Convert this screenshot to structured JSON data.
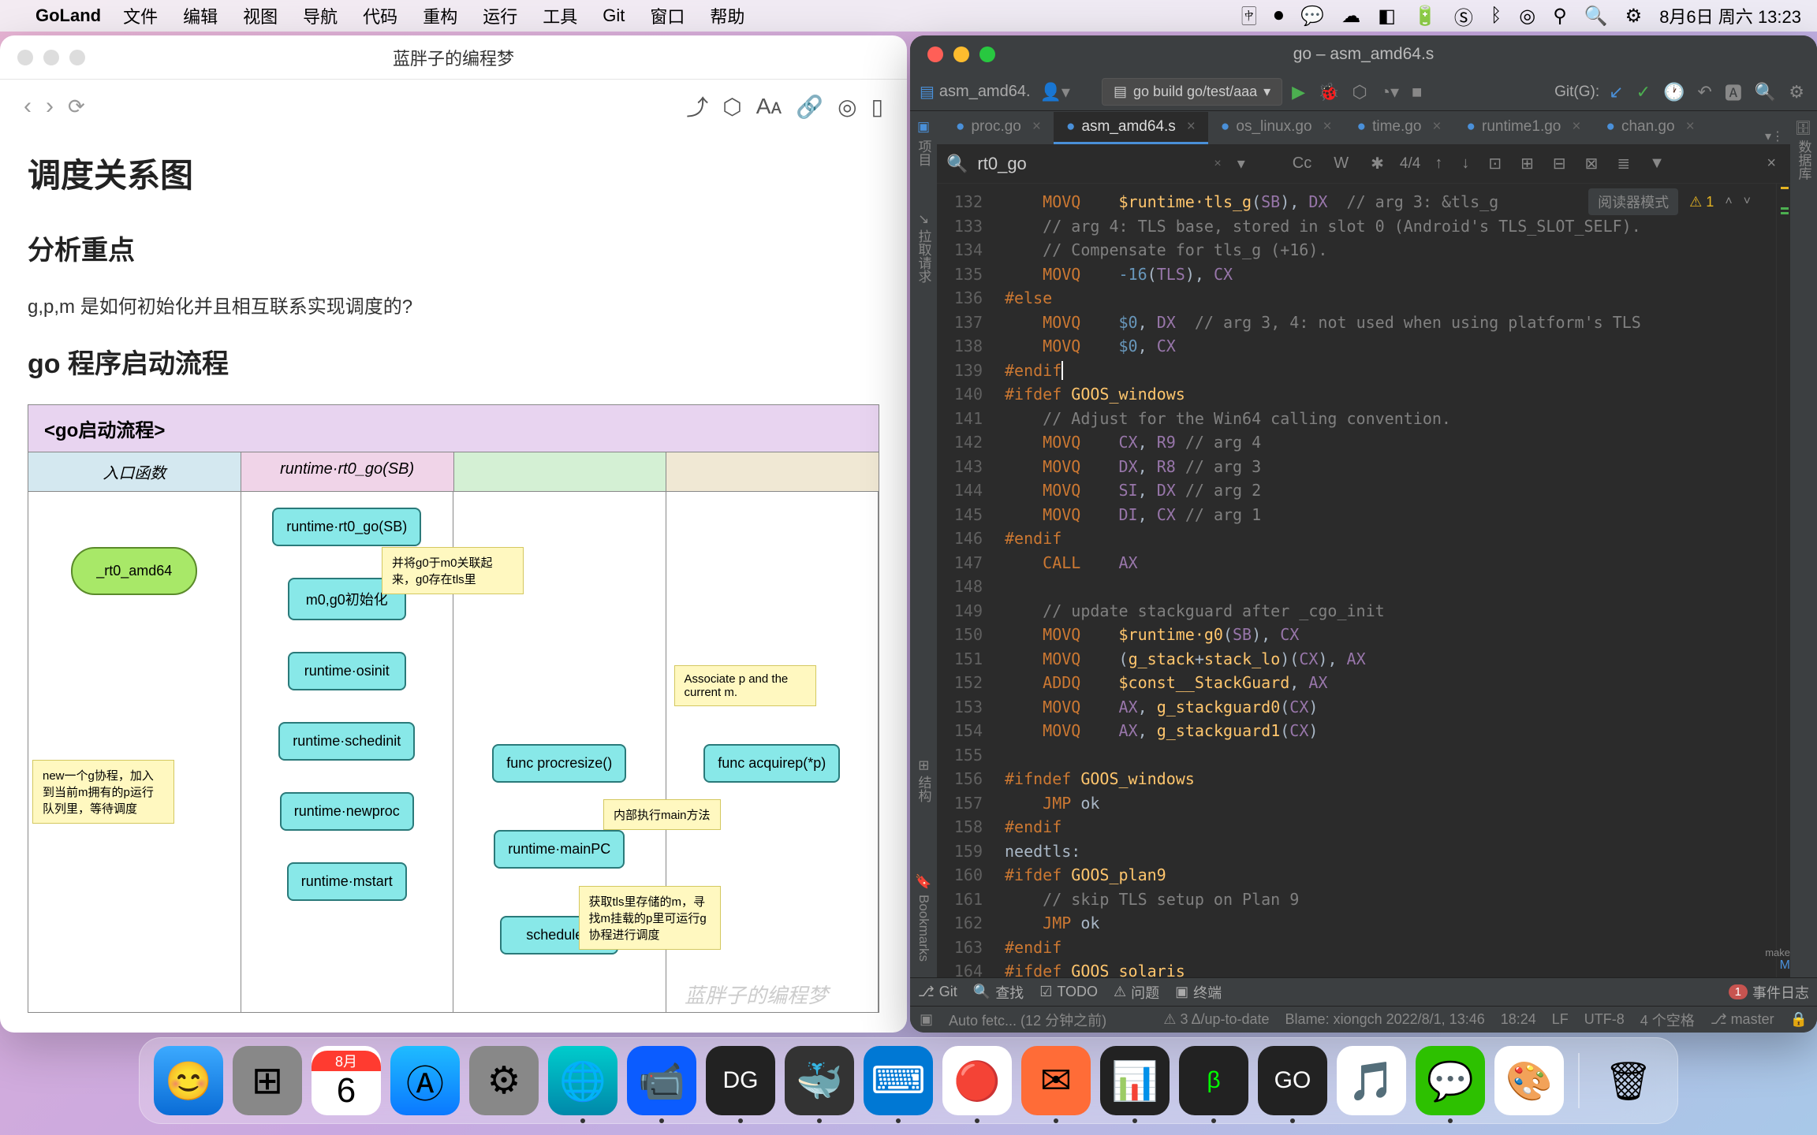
{
  "menubar": {
    "app": "GoLand",
    "items": [
      "文件",
      "编辑",
      "视图",
      "导航",
      "代码",
      "重构",
      "运行",
      "工具",
      "Git",
      "窗口",
      "帮助"
    ],
    "date": "8月6日",
    "weekday": "周六",
    "time": "13:23"
  },
  "notes": {
    "title": "蓝胖子的编程梦",
    "h1": "调度关系图",
    "h2a": "分析重点",
    "para1": "g,p,m 是如何初始化并且相互联系实现调度的?",
    "h2b": "go 程序启动流程",
    "flowchart": {
      "title": "<go启动流程>",
      "cols": [
        "入口函数",
        "runtime·rt0_go(SB)",
        "",
        ""
      ],
      "nodes": {
        "start": "_rt0_amd64",
        "n1": "runtime·rt0_go(SB)",
        "n2": "m0,g0初始化",
        "n3": "runtime·osinit",
        "n4": "runtime·schedinit",
        "n5": "runtime·newproc",
        "n6": "runtime·mstart",
        "n7": "func procresize()",
        "n8": "runtime·mainPC",
        "n9": "schedule()",
        "n10": "func acquirep(*p)"
      },
      "notes": {
        "note1": "并将g0于m0关联起来，g0存在tls里",
        "note2": "Associate p and the current m.",
        "note3": "new一个g协程，加入到当前m拥有的p运行队列里，等待调度",
        "note4": "内部执行main方法",
        "note5": "获取tls里存储的m，寻找m挂载的p里可运行g协程进行调度"
      }
    },
    "watermark": "蓝胖子的编程梦"
  },
  "ide": {
    "title": "go – asm_amd64.s",
    "crumb": "asm_amd64.",
    "run_config": "go build go/test/aaa",
    "git_label": "Git(G):",
    "tabs": [
      {
        "name": "proc.go",
        "active": false
      },
      {
        "name": "asm_amd64.s",
        "active": true
      },
      {
        "name": "os_linux.go",
        "active": false
      },
      {
        "name": "time.go",
        "active": false
      },
      {
        "name": "runtime1.go",
        "active": false
      },
      {
        "name": "chan.go",
        "active": false
      }
    ],
    "search": {
      "query": "rt0_go",
      "match": "4/4",
      "cc": "Cc",
      "w": "W"
    },
    "reader_mode": "阅读器模式",
    "warn_count": "1",
    "left_tool_tabs": [
      "项目",
      "拉取请求",
      "结构",
      "Bookmarks"
    ],
    "right_tool_tabs": [
      "数据库"
    ],
    "gutter_start": 132,
    "code": [
      {
        "indent": 2,
        "t": [
          {
            "c": "kw",
            "s": "MOVQ"
          },
          {
            "s": "    "
          },
          {
            "c": "fn",
            "s": "$runtime·tls_g"
          },
          {
            "s": "("
          },
          {
            "c": "reg",
            "s": "SB"
          },
          {
            "s": "), "
          },
          {
            "c": "reg",
            "s": "DX"
          },
          {
            "s": "  "
          },
          {
            "c": "cmt",
            "s": "// arg 3: &tls_g"
          }
        ]
      },
      {
        "indent": 2,
        "t": [
          {
            "c": "cmt",
            "s": "// arg 4: TLS base, stored in slot 0 (Android's TLS_SLOT_SELF)."
          }
        ]
      },
      {
        "indent": 2,
        "t": [
          {
            "c": "cmt",
            "s": "// Compensate for tls_g (+16)."
          }
        ]
      },
      {
        "indent": 2,
        "t": [
          {
            "c": "kw",
            "s": "MOVQ"
          },
          {
            "s": "    "
          },
          {
            "c": "num",
            "s": "-16"
          },
          {
            "s": "("
          },
          {
            "c": "reg",
            "s": "TLS"
          },
          {
            "s": "), "
          },
          {
            "c": "reg",
            "s": "CX"
          }
        ]
      },
      {
        "indent": 0,
        "t": [
          {
            "c": "pp",
            "s": "#else"
          }
        ]
      },
      {
        "indent": 2,
        "t": [
          {
            "c": "kw",
            "s": "MOVQ"
          },
          {
            "s": "    "
          },
          {
            "c": "num",
            "s": "$0"
          },
          {
            "s": ", "
          },
          {
            "c": "reg",
            "s": "DX"
          },
          {
            "s": "  "
          },
          {
            "c": "cmt",
            "s": "// arg 3, 4: not used when using platform's TLS"
          }
        ]
      },
      {
        "indent": 2,
        "t": [
          {
            "c": "kw",
            "s": "MOVQ"
          },
          {
            "s": "    "
          },
          {
            "c": "num",
            "s": "$0"
          },
          {
            "s": ", "
          },
          {
            "c": "reg",
            "s": "CX"
          }
        ]
      },
      {
        "indent": 0,
        "t": [
          {
            "c": "pp",
            "s": "#endif"
          }
        ],
        "cursor": true
      },
      {
        "indent": 0,
        "t": [
          {
            "c": "pp",
            "s": "#ifdef "
          },
          {
            "c": "ppname",
            "s": "GOOS_windows"
          }
        ]
      },
      {
        "indent": 2,
        "t": [
          {
            "c": "cmt",
            "s": "// Adjust for the Win64 calling convention."
          }
        ]
      },
      {
        "indent": 2,
        "t": [
          {
            "c": "kw",
            "s": "MOVQ"
          },
          {
            "s": "    "
          },
          {
            "c": "reg",
            "s": "CX"
          },
          {
            "s": ", "
          },
          {
            "c": "reg",
            "s": "R9"
          },
          {
            "s": " "
          },
          {
            "c": "cmt",
            "s": "// arg 4"
          }
        ]
      },
      {
        "indent": 2,
        "t": [
          {
            "c": "kw",
            "s": "MOVQ"
          },
          {
            "s": "    "
          },
          {
            "c": "reg",
            "s": "DX"
          },
          {
            "s": ", "
          },
          {
            "c": "reg",
            "s": "R8"
          },
          {
            "s": " "
          },
          {
            "c": "cmt",
            "s": "// arg 3"
          }
        ]
      },
      {
        "indent": 2,
        "t": [
          {
            "c": "kw",
            "s": "MOVQ"
          },
          {
            "s": "    "
          },
          {
            "c": "reg",
            "s": "SI"
          },
          {
            "s": ", "
          },
          {
            "c": "reg",
            "s": "DX"
          },
          {
            "s": " "
          },
          {
            "c": "cmt",
            "s": "// arg 2"
          }
        ]
      },
      {
        "indent": 2,
        "t": [
          {
            "c": "kw",
            "s": "MOVQ"
          },
          {
            "s": "    "
          },
          {
            "c": "reg",
            "s": "DI"
          },
          {
            "s": ", "
          },
          {
            "c": "reg",
            "s": "CX"
          },
          {
            "s": " "
          },
          {
            "c": "cmt",
            "s": "// arg 1"
          }
        ]
      },
      {
        "indent": 0,
        "t": [
          {
            "c": "pp",
            "s": "#endif"
          }
        ]
      },
      {
        "indent": 2,
        "t": [
          {
            "c": "kw",
            "s": "CALL"
          },
          {
            "s": "    "
          },
          {
            "c": "reg",
            "s": "AX"
          }
        ]
      },
      {
        "indent": 0,
        "t": []
      },
      {
        "indent": 2,
        "t": [
          {
            "c": "cmt",
            "s": "// update stackguard after _cgo_init"
          }
        ]
      },
      {
        "indent": 2,
        "t": [
          {
            "c": "kw",
            "s": "MOVQ"
          },
          {
            "s": "    "
          },
          {
            "c": "fn",
            "s": "$runtime·g0"
          },
          {
            "s": "("
          },
          {
            "c": "reg",
            "s": "SB"
          },
          {
            "s": "), "
          },
          {
            "c": "reg",
            "s": "CX"
          }
        ]
      },
      {
        "indent": 2,
        "t": [
          {
            "c": "kw",
            "s": "MOVQ"
          },
          {
            "s": "    ("
          },
          {
            "c": "fn",
            "s": "g_stack"
          },
          {
            "s": "+"
          },
          {
            "c": "fn",
            "s": "stack_lo"
          },
          {
            "s": ")("
          },
          {
            "c": "reg",
            "s": "CX"
          },
          {
            "s": "), "
          },
          {
            "c": "reg",
            "s": "AX"
          }
        ]
      },
      {
        "indent": 2,
        "t": [
          {
            "c": "kw",
            "s": "ADDQ"
          },
          {
            "s": "    "
          },
          {
            "c": "fn",
            "s": "$const__StackGuard"
          },
          {
            "s": ", "
          },
          {
            "c": "reg",
            "s": "AX"
          }
        ]
      },
      {
        "indent": 2,
        "t": [
          {
            "c": "kw",
            "s": "MOVQ"
          },
          {
            "s": "    "
          },
          {
            "c": "reg",
            "s": "AX"
          },
          {
            "s": ", "
          },
          {
            "c": "fn",
            "s": "g_stackguard0"
          },
          {
            "s": "("
          },
          {
            "c": "reg",
            "s": "CX"
          },
          {
            "s": ")"
          }
        ]
      },
      {
        "indent": 2,
        "t": [
          {
            "c": "kw",
            "s": "MOVQ"
          },
          {
            "s": "    "
          },
          {
            "c": "reg",
            "s": "AX"
          },
          {
            "s": ", "
          },
          {
            "c": "fn",
            "s": "g_stackguard1"
          },
          {
            "s": "("
          },
          {
            "c": "reg",
            "s": "CX"
          },
          {
            "s": ")"
          }
        ]
      },
      {
        "indent": 0,
        "t": []
      },
      {
        "indent": 0,
        "t": [
          {
            "c": "pp",
            "s": "#ifndef "
          },
          {
            "c": "ppname",
            "s": "GOOS_windows"
          }
        ]
      },
      {
        "indent": 2,
        "t": [
          {
            "c": "kw",
            "s": "JMP "
          },
          {
            "c": "sym",
            "s": "ok"
          }
        ]
      },
      {
        "indent": 0,
        "t": [
          {
            "c": "pp",
            "s": "#endif"
          }
        ]
      },
      {
        "indent": 0,
        "t": [
          {
            "c": "sym",
            "s": "needtls:"
          }
        ]
      },
      {
        "indent": 0,
        "t": [
          {
            "c": "pp",
            "s": "#ifdef "
          },
          {
            "c": "ppname",
            "s": "GOOS_plan9"
          }
        ]
      },
      {
        "indent": 2,
        "t": [
          {
            "c": "cmt",
            "s": "// skip TLS setup on Plan 9"
          }
        ]
      },
      {
        "indent": 2,
        "t": [
          {
            "c": "kw",
            "s": "JMP "
          },
          {
            "c": "sym",
            "s": "ok"
          }
        ]
      },
      {
        "indent": 0,
        "t": [
          {
            "c": "pp",
            "s": "#endif"
          }
        ]
      },
      {
        "indent": 0,
        "t": [
          {
            "c": "pp",
            "s": "#ifdef "
          },
          {
            "c": "ppname",
            "s": "GOOS_solaris"
          }
        ]
      }
    ],
    "bottom_tabs": {
      "git": "Git",
      "find": "查找",
      "todo": "TODO",
      "problems": "问题",
      "terminal": "终端",
      "events": "事件日志",
      "event_count": "1"
    },
    "status": {
      "fetch": "Auto fetc... (12 分钟之前)",
      "head": "3 Δ/up-to-date",
      "blame": "Blame: xiongch 2022/8/1, 13:46",
      "time": "18:24",
      "lf": "LF",
      "enc": "UTF-8",
      "indent": "4 个空格",
      "branch": "master"
    }
  },
  "dock": {
    "icons": [
      "finder",
      "launchpad",
      "calendar",
      "appstore",
      "settings",
      "edge",
      "zoom",
      "datagrip",
      "docker",
      "vscode",
      "chrome",
      "postman",
      "activity",
      "iterm",
      "goland",
      "music",
      "wechat",
      "preview"
    ],
    "cal_month": "8月",
    "cal_day": "6"
  }
}
